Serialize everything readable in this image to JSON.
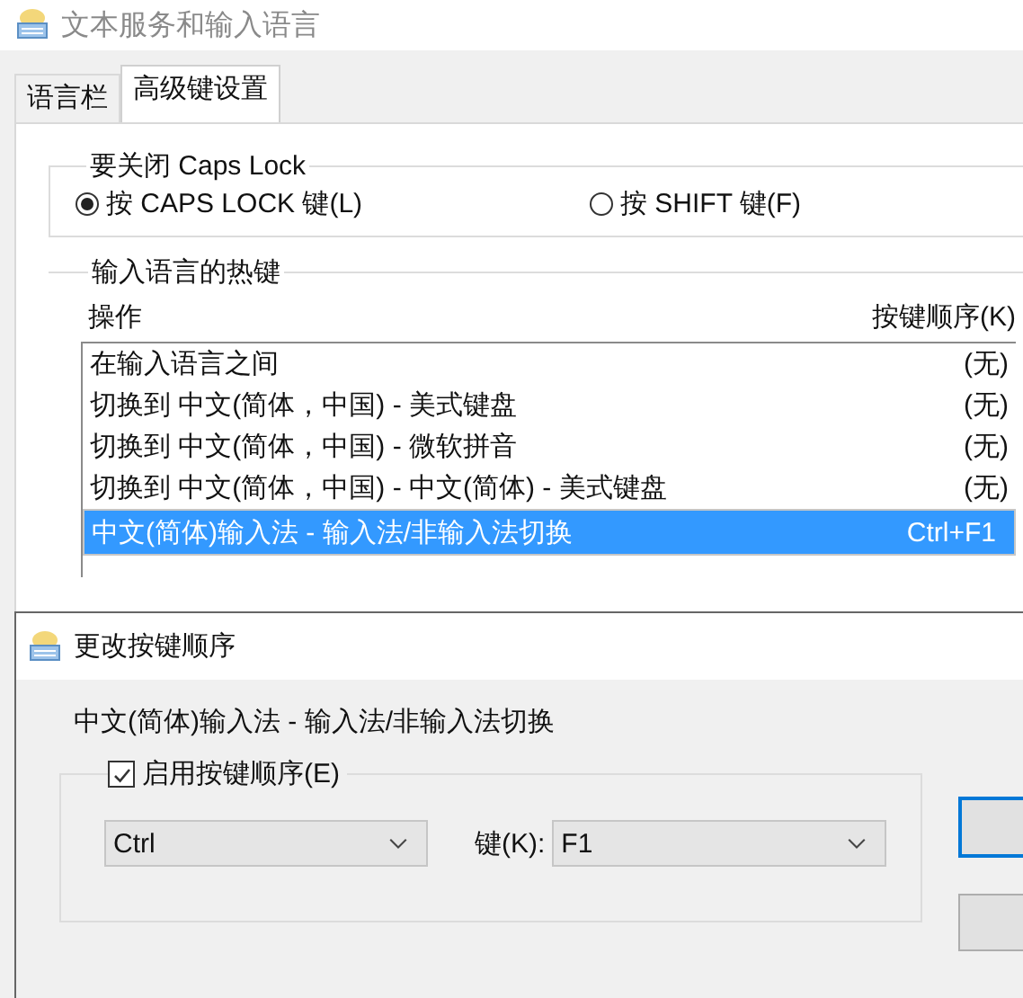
{
  "window": {
    "title": "文本服务和输入语言"
  },
  "tabs": [
    {
      "label": "语言栏",
      "selected": false
    },
    {
      "label": "高级键设置",
      "selected": true
    }
  ],
  "caps_lock_group": {
    "title": "要关闭 Caps Lock",
    "options": [
      {
        "label": "按 CAPS LOCK 键(L)",
        "selected": true
      },
      {
        "label": "按 SHIFT 键(F)",
        "selected": false
      }
    ]
  },
  "hotkeys_group": {
    "title": "输入语言的热键",
    "columns": [
      "操作",
      "按键顺序(K)"
    ],
    "rows": [
      {
        "action": "在输入语言之间",
        "keys": "(无)",
        "selected": false
      },
      {
        "action": "切换到 中文(简体，中国) - 美式键盘",
        "keys": "(无)",
        "selected": false
      },
      {
        "action": "切换到 中文(简体，中国) - 微软拼音",
        "keys": "(无)",
        "selected": false
      },
      {
        "action": "切换到 中文(简体，中国) - 中文(简体) - 美式键盘",
        "keys": "(无)",
        "selected": false
      },
      {
        "action": "中文(简体)输入法 - 输入法/非输入法切换",
        "keys": "Ctrl+F1",
        "selected": true
      }
    ]
  },
  "dialog": {
    "title": "更改按键顺序",
    "description": "中文(简体)输入法 - 输入法/非输入法切换",
    "enable": {
      "label": "启用按键顺序(E)",
      "checked": true
    },
    "modifier": {
      "value": "Ctrl"
    },
    "key": {
      "label": "键(K):",
      "value": "F1"
    }
  }
}
